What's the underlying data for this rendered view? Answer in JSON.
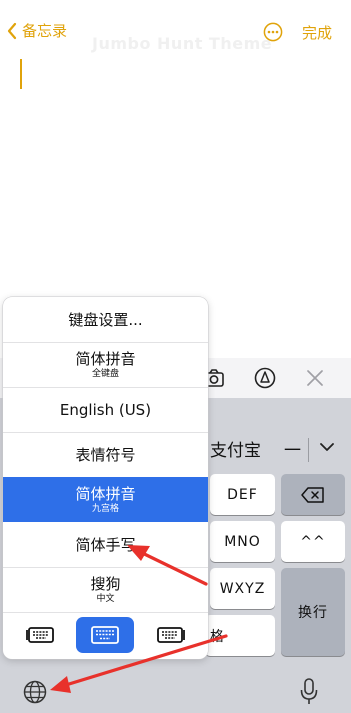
{
  "header": {
    "back_label": "备忘录",
    "done_label": "完成",
    "ghost_title": "Jumbo Hunt Theme"
  },
  "keyboard": {
    "candidate": "支付宝",
    "candidate_dash": "一",
    "keys": {
      "def": "DEF",
      "mno": "MNO",
      "wxyz": "WXYZ",
      "caret": "^^",
      "return": "换行",
      "space_partial": "格"
    }
  },
  "popup": {
    "items": [
      {
        "main": "键盘设置...",
        "sub": ""
      },
      {
        "main": "简体拼音",
        "sub": "全键盘"
      },
      {
        "main": "English (US)",
        "sub": ""
      },
      {
        "main": "表情符号",
        "sub": ""
      },
      {
        "main": "简体拼音",
        "sub": "九宫格"
      },
      {
        "main": "简体手写",
        "sub": ""
      },
      {
        "main": "搜狗",
        "sub": "中文"
      }
    ]
  },
  "colors": {
    "accent": "#e0a30b",
    "selected": "#2e6fe8",
    "arrow": "#e8312b",
    "keyboard_bg": "#d1d3d9"
  }
}
